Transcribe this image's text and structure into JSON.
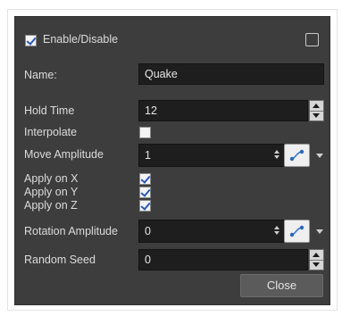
{
  "header": {
    "enable_label": "Enable/Disable",
    "enable_checked": true
  },
  "name": {
    "label": "Name:",
    "value": "Quake"
  },
  "hold_time": {
    "label": "Hold Time",
    "value": "12"
  },
  "interpolate": {
    "label": "Interpolate",
    "checked": false
  },
  "move_amplitude": {
    "label": "Move Amplitude",
    "value": "1"
  },
  "apply": [
    {
      "label": "Apply on X",
      "checked": true
    },
    {
      "label": "Apply on Y",
      "checked": true
    },
    {
      "label": "Apply on Z",
      "checked": true
    }
  ],
  "rotation_amplitude": {
    "label": "Rotation Amplitude",
    "value": "0"
  },
  "random_seed": {
    "label": "Random Seed",
    "value": "0"
  },
  "close_button": {
    "label": "Close"
  },
  "colors": {
    "panel_bg": "#3d3d3d",
    "field_bg": "#1e1e1e",
    "checkmark": "#2a58b8",
    "button_bg": "#5b5b5b"
  }
}
